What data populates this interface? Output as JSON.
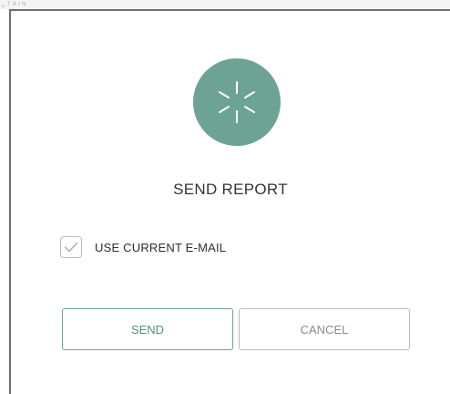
{
  "background": {
    "fragment_text": "ᵥ ᵀ ᴬ ᴵ ᴺ"
  },
  "dialog": {
    "status_icon": "spinner-icon",
    "title": "SEND REPORT",
    "checkbox": {
      "label": "USE CURRENT E-MAIL",
      "checked": true
    },
    "buttons": {
      "send_label": "SEND",
      "cancel_label": "CANCEL"
    }
  },
  "colors": {
    "accent": "#6da395",
    "accent_text": "#55907f",
    "title_text": "#333333",
    "muted_text": "#8a8a8a",
    "border_gray": "#b9b9b9"
  }
}
